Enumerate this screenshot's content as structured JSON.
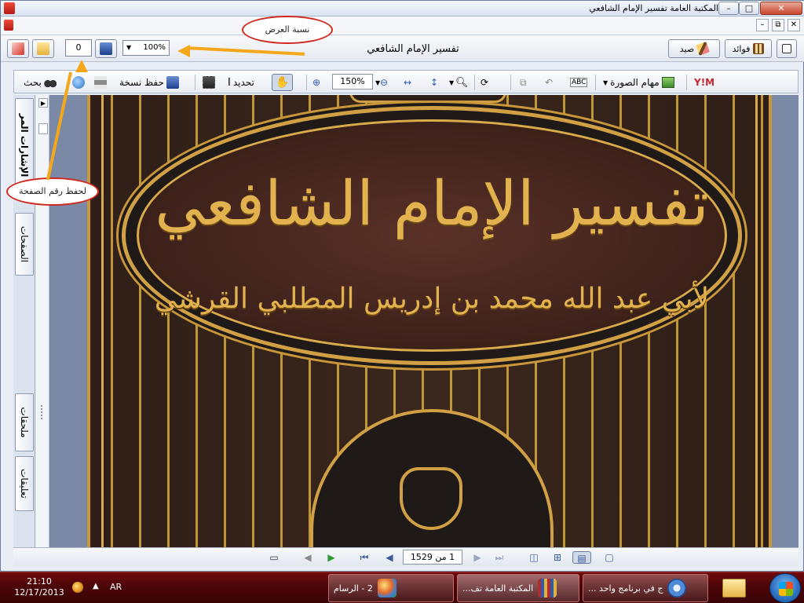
{
  "window": {
    "title": "المكتبة العامة   تفسير الإمام الشافعي",
    "controls": {
      "minimize": "–",
      "maximize": "□",
      "close": "✕"
    }
  },
  "menustrip": {
    "minimize": "–",
    "restore": "⧉",
    "close": "✕"
  },
  "toolbar": {
    "book_title": "تفسير الإمام الشافعي",
    "fawaid_label": "فوائد",
    "sayd_label": "صيد",
    "page_number_value": "0",
    "zoom_ratio": "100%"
  },
  "viewer_toolbar": {
    "search_label": "بحث",
    "save_copy_label": "حفظ نسخة",
    "select_label": "تحديد",
    "zoom_value": "150%",
    "image_tasks_label": "مهام الصورة",
    "yim_label": "Y!M"
  },
  "sidebar": {
    "tabs": [
      "الإشارات المر",
      "الصفحات",
      "ملحقات",
      "تعليقات"
    ]
  },
  "document": {
    "cover_title": "تفسير الإمام الشافعي",
    "cover_subtitle": "لأبي عبد الله محمد بن إدريس المطلبي القرشي"
  },
  "statusbar": {
    "page_indicator": "1 من 1529"
  },
  "callouts": {
    "zoom_ratio_label": "نسبة العرض",
    "save_page_label": "لحفظ رقم الصفحة"
  },
  "taskbar": {
    "time": "21:10",
    "date": "12/17/2013",
    "language": "AR",
    "tasks": [
      {
        "label": "ج في برنامج واحد ..."
      },
      {
        "label": "المكتبة العامة  تف..."
      },
      {
        "label": "2 - الرسام"
      }
    ]
  }
}
